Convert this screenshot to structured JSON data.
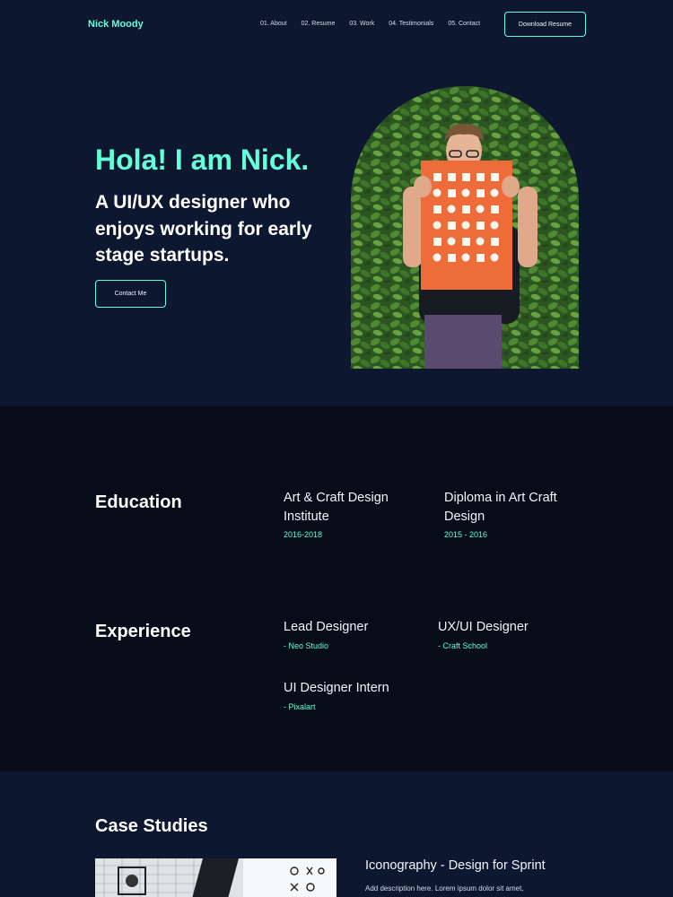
{
  "nav": {
    "logo": "Nick Moody",
    "links": [
      "01. About",
      "02. Resume",
      "03. Work",
      "04. Testimonials",
      "05. Contact"
    ],
    "download_button": "Download Resume"
  },
  "hero": {
    "greeting": "Hola! I am Nick.",
    "tagline": "A UI/UX designer who enjoys working for early stage startups.",
    "contact_button": "Contact Me"
  },
  "education": {
    "title": "Education",
    "items": [
      {
        "title": "Art & Craft Design Institute",
        "years": "2016-2018"
      },
      {
        "title": "Diploma in Art Craft Design",
        "years": "2015 - 2016"
      }
    ]
  },
  "experience": {
    "title": "Experience",
    "items": [
      {
        "title": "Lead Designer",
        "company": "- Neo Studio"
      },
      {
        "title": "UX/UI Designer",
        "company": "- Craft School"
      },
      {
        "title": "UI Designer Intern",
        "company": "- Pixalart"
      }
    ]
  },
  "case_studies": {
    "title": "Case Studies",
    "items": [
      {
        "title": "Iconography - Design for Sprint",
        "description": "Add description here. Lorem ipsum dolor sit amet,"
      }
    ]
  },
  "colors": {
    "accent": "#64ffda",
    "background": "#0d1830",
    "section_dark": "#070c19",
    "poster": "#ee6b3a"
  }
}
